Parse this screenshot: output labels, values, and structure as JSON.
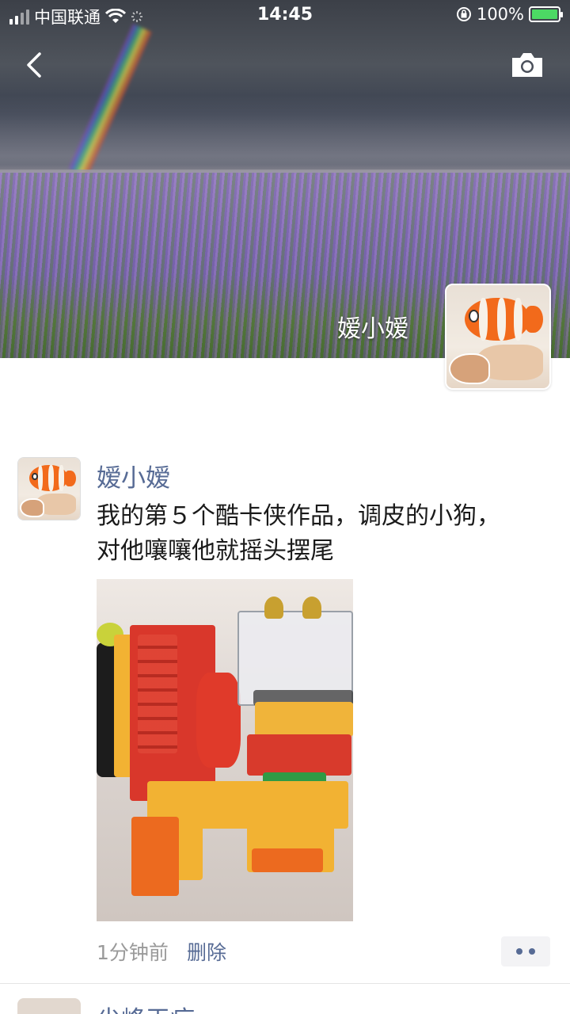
{
  "status_bar": {
    "carrier": "中国联通",
    "time": "14:45",
    "battery": "100%"
  },
  "cover": {
    "user_name": "嫒小嫒"
  },
  "post": {
    "author": "嫒小嫒",
    "text_line1": "我的第５个酷卡侠作品，调皮的小狗，",
    "text_line2": "对他嚷嚷他就摇头摆尾",
    "time_ago": "1分钟前",
    "delete_label": "删除"
  },
  "next_post": {
    "author": "尖峰王病"
  },
  "colors": {
    "link": "#576b95",
    "battery": "#4cd964"
  },
  "icons": [
    "back-arrow-icon",
    "camera-icon",
    "wifi-icon",
    "signal-icon",
    "rotation-lock-icon",
    "battery-icon"
  ]
}
